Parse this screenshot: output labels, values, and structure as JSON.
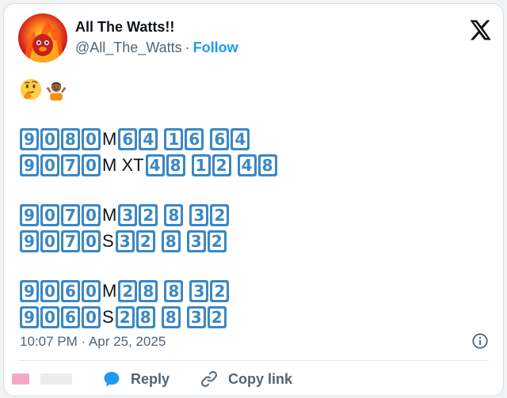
{
  "tweet": {
    "display_name": "All The Watts!!",
    "handle": "@All_The_Watts",
    "separator": "·",
    "follow_label": "Follow",
    "emojis": [
      "thinking-face-emoji",
      "person-shrugging-emoji"
    ],
    "body_lines": [
      [
        {
          "k": "9"
        },
        {
          "k": "0"
        },
        {
          "k": "8"
        },
        {
          "k": "0"
        },
        {
          "t": "M"
        },
        {
          "k": "6"
        },
        {
          "k": "4"
        },
        {
          "g": " "
        },
        {
          "k": "1"
        },
        {
          "k": "6"
        },
        {
          "g": " "
        },
        {
          "k": "6"
        },
        {
          "k": "4"
        }
      ],
      [
        {
          "k": "9"
        },
        {
          "k": "0"
        },
        {
          "k": "7"
        },
        {
          "k": "0"
        },
        {
          "t": "M XT"
        },
        {
          "k": "4"
        },
        {
          "k": "8"
        },
        {
          "g": " "
        },
        {
          "k": "1"
        },
        {
          "k": "2"
        },
        {
          "g": " "
        },
        {
          "k": "4"
        },
        {
          "k": "8"
        }
      ],
      null,
      [
        {
          "k": "9"
        },
        {
          "k": "0"
        },
        {
          "k": "7"
        },
        {
          "k": "0"
        },
        {
          "t": "M"
        },
        {
          "k": "3"
        },
        {
          "k": "2"
        },
        {
          "g": " "
        },
        {
          "k": "8"
        },
        {
          "g": " "
        },
        {
          "k": "3"
        },
        {
          "k": "2"
        }
      ],
      [
        {
          "k": "9"
        },
        {
          "k": "0"
        },
        {
          "k": "7"
        },
        {
          "k": "0"
        },
        {
          "t": "S"
        },
        {
          "k": "3"
        },
        {
          "k": "2"
        },
        {
          "g": " "
        },
        {
          "k": "8"
        },
        {
          "g": " "
        },
        {
          "k": "3"
        },
        {
          "k": "2"
        }
      ],
      null,
      [
        {
          "k": "9"
        },
        {
          "k": "0"
        },
        {
          "k": "6"
        },
        {
          "k": "0"
        },
        {
          "t": "M"
        },
        {
          "k": "2"
        },
        {
          "k": "8"
        },
        {
          "g": " "
        },
        {
          "k": "8"
        },
        {
          "g": " "
        },
        {
          "k": "3"
        },
        {
          "k": "2"
        }
      ],
      [
        {
          "k": "9"
        },
        {
          "k": "0"
        },
        {
          "k": "6"
        },
        {
          "k": "0"
        },
        {
          "t": "S"
        },
        {
          "k": "2"
        },
        {
          "k": "8"
        },
        {
          "g": " "
        },
        {
          "k": "8"
        },
        {
          "g": " "
        },
        {
          "k": "3"
        },
        {
          "k": "2"
        }
      ]
    ],
    "timestamp": "10:07 PM · Apr 25, 2025"
  },
  "actions": {
    "reply_label": "Reply",
    "copy_link_label": "Copy link"
  },
  "colors": {
    "accent": "#1d9bf0",
    "keycap": "#3b88c3",
    "text_primary": "#0f1419",
    "text_secondary": "#536471"
  },
  "icons": {
    "brand": "x-logo-icon",
    "info": "info-icon",
    "reply": "speech-bubble-icon",
    "copy_link": "link-icon"
  }
}
